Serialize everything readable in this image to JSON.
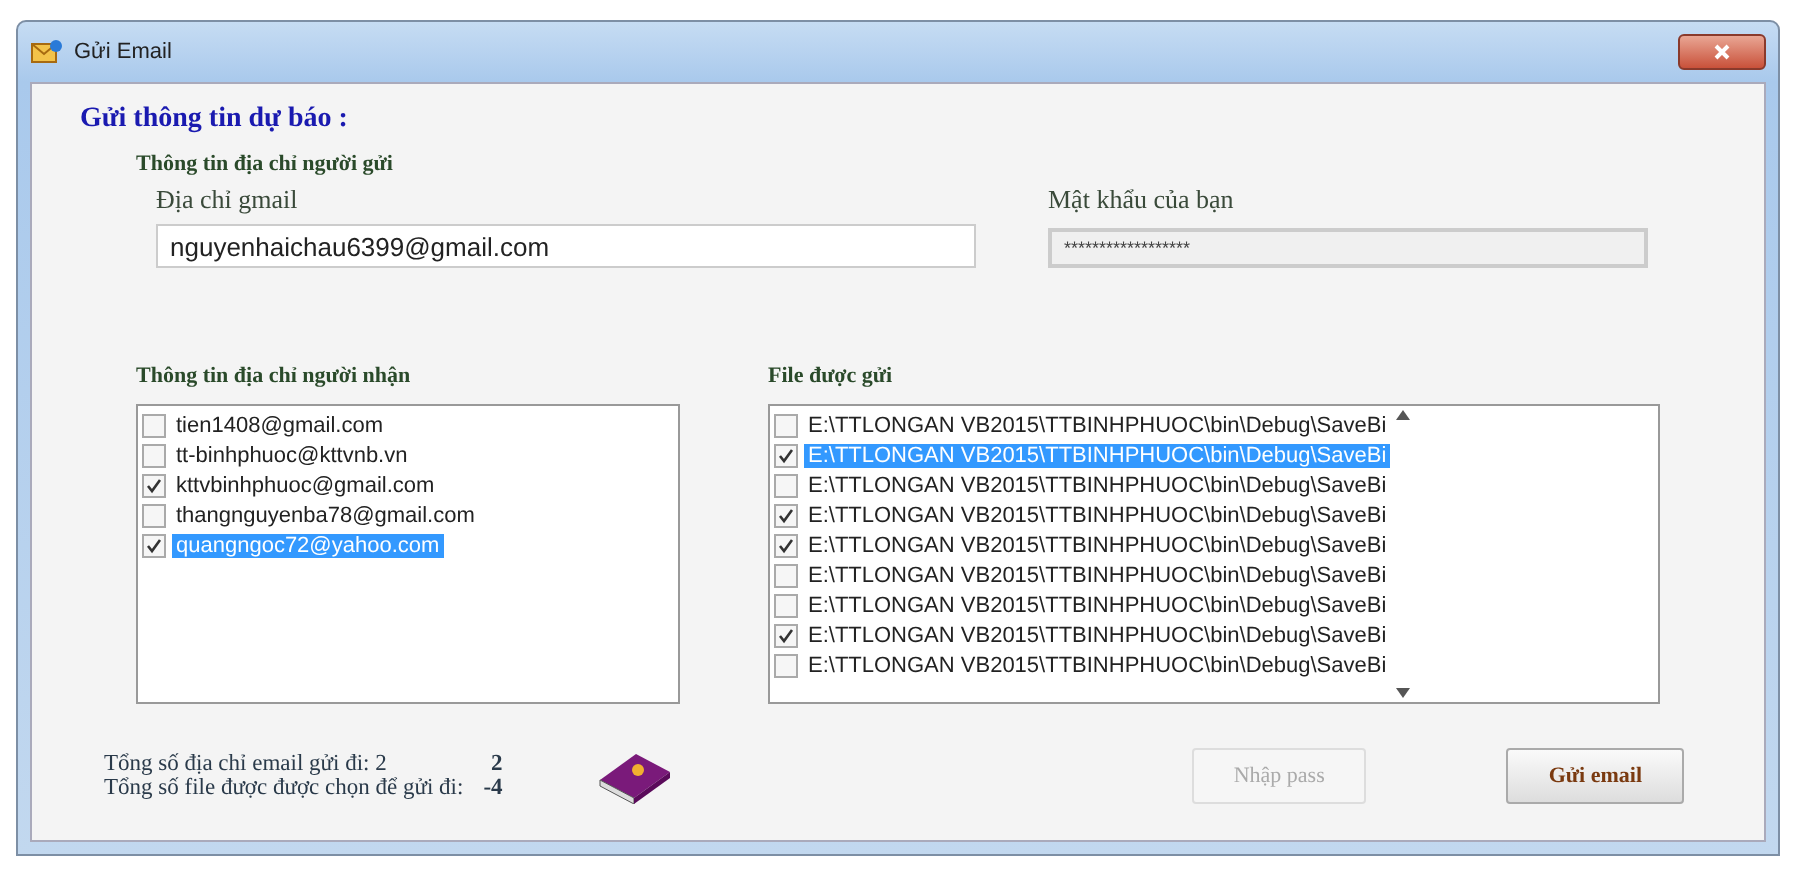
{
  "window": {
    "title": "Gửi Email"
  },
  "heading": "Gửi  thông tin dự báo :",
  "sender": {
    "title": "Thông tin địa chỉ người gửi",
    "email": {
      "label": "Địa chỉ gmail",
      "value": "nguyenhaichau6399@gmail.com"
    },
    "password": {
      "label": "Mật khẩu của bạn",
      "value": "******************"
    }
  },
  "recipients": {
    "title": "Thông tin địa chỉ người nhận",
    "items": [
      {
        "label": "tien1408@gmail.com",
        "checked": false,
        "selected": false
      },
      {
        "label": "tt-binhphuoc@kttvnb.vn",
        "checked": false,
        "selected": false
      },
      {
        "label": "kttvbinhphuoc@gmail.com",
        "checked": true,
        "selected": false
      },
      {
        "label": "thangnguyenba78@gmail.com",
        "checked": false,
        "selected": false
      },
      {
        "label": "quangngoc72@yahoo.com",
        "checked": true,
        "selected": true
      }
    ]
  },
  "files": {
    "title": "File được gửi",
    "items": [
      {
        "label": "E:\\TTLONGAN VB2015\\TTBINHPHUOC\\bin\\Debug\\SaveBi",
        "checked": false,
        "selected": false
      },
      {
        "label": "E:\\TTLONGAN VB2015\\TTBINHPHUOC\\bin\\Debug\\SaveBi",
        "checked": true,
        "selected": true
      },
      {
        "label": "E:\\TTLONGAN VB2015\\TTBINHPHUOC\\bin\\Debug\\SaveBi",
        "checked": false,
        "selected": false
      },
      {
        "label": "E:\\TTLONGAN VB2015\\TTBINHPHUOC\\bin\\Debug\\SaveBi",
        "checked": true,
        "selected": false
      },
      {
        "label": "E:\\TTLONGAN VB2015\\TTBINHPHUOC\\bin\\Debug\\SaveBi",
        "checked": true,
        "selected": false
      },
      {
        "label": "E:\\TTLONGAN VB2015\\TTBINHPHUOC\\bin\\Debug\\SaveBi",
        "checked": false,
        "selected": false
      },
      {
        "label": "E:\\TTLONGAN VB2015\\TTBINHPHUOC\\bin\\Debug\\SaveBi",
        "checked": false,
        "selected": false
      },
      {
        "label": "E:\\TTLONGAN VB2015\\TTBINHPHUOC\\bin\\Debug\\SaveBi",
        "checked": true,
        "selected": false
      },
      {
        "label": "E:\\TTLONGAN VB2015\\TTBINHPHUOC\\bin\\Debug\\SaveBi",
        "checked": false,
        "selected": false
      }
    ]
  },
  "summary": [
    {
      "label": "Tổng số địa chỉ email gửi đi: 2",
      "value": "2"
    },
    {
      "label": "Tổng số file được được chọn để gửi đi:",
      "value": "-4"
    }
  ],
  "buttons": [
    {
      "label": "Nhập pass",
      "disabled": true
    },
    {
      "label": "Gửi email",
      "disabled": false
    }
  ]
}
